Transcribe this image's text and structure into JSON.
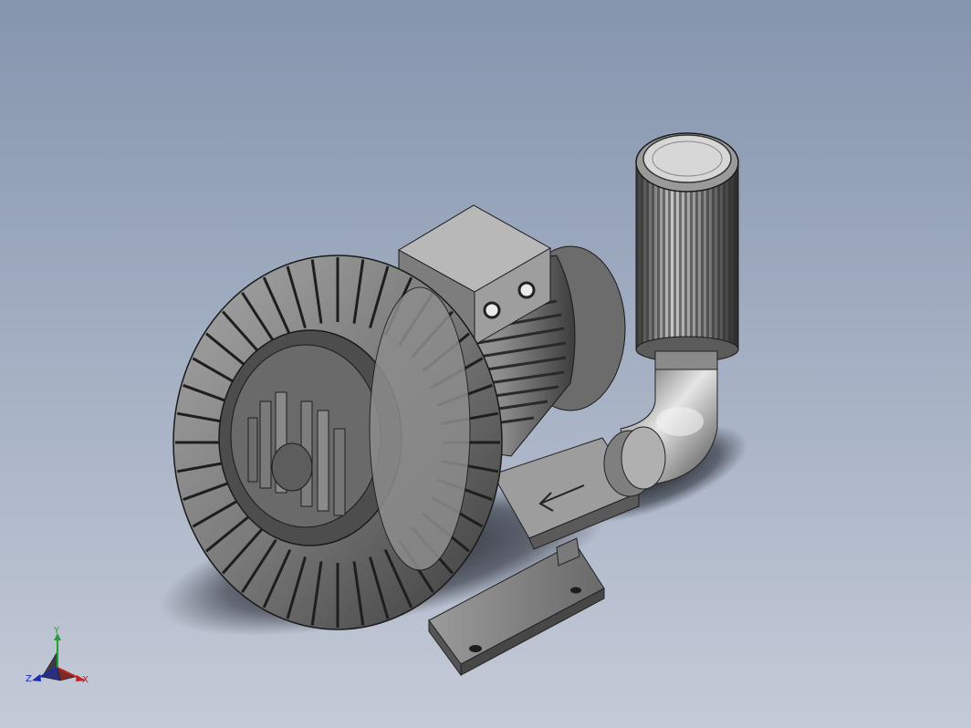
{
  "viewport": {
    "background_top": "#8595ad",
    "background_bottom": "#c4cad7"
  },
  "model": {
    "parts": [
      "filter-cartridge",
      "elbow-pipe",
      "inlet-tube",
      "terminal-box",
      "motor-housing",
      "blower-ring",
      "impeller-hub",
      "mounting-foot",
      "flow-arrow"
    ],
    "body_color": "#8e8e8e",
    "shadow_color": "#1a1e26"
  },
  "triad": {
    "x_label": "X",
    "y_label": "Y",
    "z_label": "Z",
    "x_color": "#c02020",
    "y_color": "#22a030",
    "z_color": "#1b2bb0"
  }
}
